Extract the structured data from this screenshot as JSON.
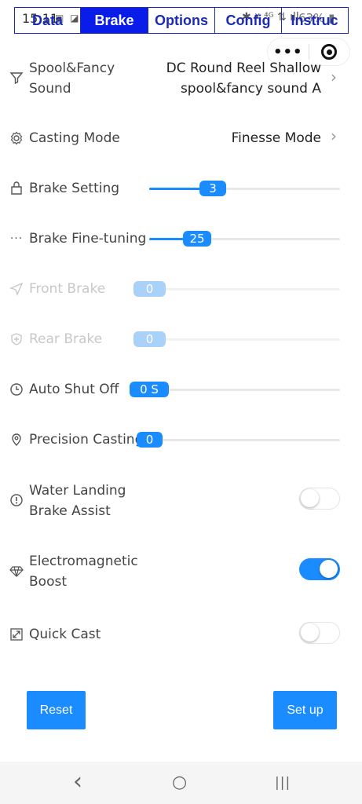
{
  "status": {
    "time": "15:11",
    "left_icons": "▣ ◪ ◈ ·",
    "right_icons": "✱ ☓ ⁴ᴳ ⇅ ıll",
    "battery": "63% ▮"
  },
  "tabs": [
    {
      "label": "Data",
      "active": false
    },
    {
      "label": "Brake",
      "active": true
    },
    {
      "label": "Options",
      "active": false
    },
    {
      "label": "Config",
      "active": false
    },
    {
      "label": "Instruc",
      "active": false
    }
  ],
  "capsule": {
    "more_icon": "•••",
    "target_icon": "target-icon"
  },
  "rows": {
    "spool": {
      "label_line1": "Spool&Fancy",
      "label_line2": "Sound",
      "value_line1": "DC Round Reel Shallow",
      "value_line2": "spool&fancy sound A",
      "icon": "filter-icon"
    },
    "casting_mode": {
      "label": "Casting Mode",
      "value": "Finesse Mode",
      "icon": "gear-icon"
    },
    "brake_setting": {
      "label": "Brake Setting",
      "value": "3",
      "fraction": 0.33,
      "icon": "bag-icon"
    },
    "brake_fine": {
      "label": "Brake Fine-tuning",
      "value": "25",
      "fraction": 0.25,
      "icon": "ellipsis-icon"
    },
    "front_brake": {
      "label": "Front Brake",
      "value": "0",
      "fraction": 0.0,
      "disabled": true,
      "icon": "send-icon"
    },
    "rear_brake": {
      "label": "Rear Brake",
      "value": "0",
      "fraction": 0.0,
      "disabled": true,
      "icon": "shield-plus-icon"
    },
    "auto_shut_off": {
      "label": "Auto Shut Off",
      "value": "0 S",
      "fraction": 0.0,
      "icon": "clock-icon"
    },
    "precision_casting": {
      "label": "Precision Casting",
      "value": "0",
      "fraction": 0.0,
      "icon": "location-pin-icon"
    },
    "water_landing": {
      "label_line1": "Water Landing",
      "label_line2": "Brake Assist",
      "on": false,
      "icon": "alert-circle-icon"
    },
    "electromagnetic": {
      "label_line1": "Electromagnetic",
      "label_line2": "Boost",
      "on": true,
      "icon": "diamond-icon"
    },
    "quick_cast": {
      "label": "Quick Cast",
      "on": false,
      "icon": "expand-icon"
    }
  },
  "buttons": {
    "reset": "Reset",
    "setup": "Set up"
  },
  "navbar": {
    "back": "‹",
    "home": "○",
    "recents": "|||"
  },
  "colors": {
    "accent": "#1a8cff",
    "tab_active": "#0a1de8",
    "tab_border": "#1d2bb3"
  }
}
